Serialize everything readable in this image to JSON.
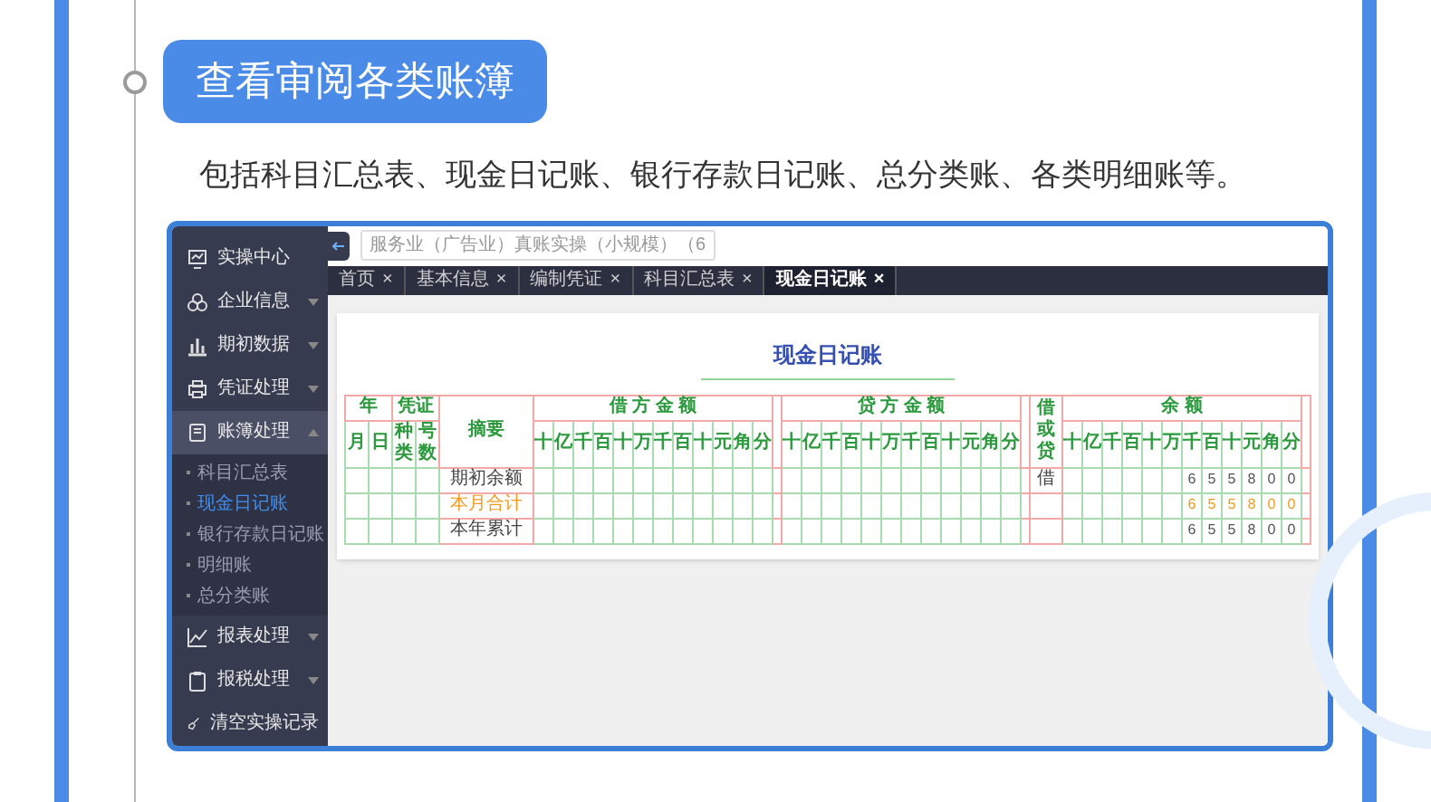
{
  "page": {
    "title": "查看审阅各类账簿",
    "description": "包括科目汇总表、现金日记账、银行存款日记账、总分类账、各类明细账等。"
  },
  "app": {
    "sidebar": {
      "items": [
        {
          "label": "实操中心",
          "kind": "link"
        },
        {
          "label": "企业信息",
          "kind": "group",
          "expanded": false
        },
        {
          "label": "期初数据",
          "kind": "group",
          "expanded": false
        },
        {
          "label": "凭证处理",
          "kind": "group",
          "expanded": false
        },
        {
          "label": "账簿处理",
          "kind": "group",
          "expanded": true,
          "children": [
            {
              "label": "科目汇总表",
              "selected": false
            },
            {
              "label": "现金日记账",
              "selected": true
            },
            {
              "label": "银行存款日记账",
              "selected": false
            },
            {
              "label": "明细账",
              "selected": false
            },
            {
              "label": "总分类账",
              "selected": false
            }
          ]
        },
        {
          "label": "报表处理",
          "kind": "group",
          "expanded": false
        },
        {
          "label": "报税处理",
          "kind": "group",
          "expanded": false
        },
        {
          "label": "清空实操记录",
          "kind": "link"
        }
      ]
    },
    "search": {
      "value": "服务业（广告业）真账实操（小规模）（6"
    },
    "tabs": [
      {
        "label": "首页",
        "close": "×",
        "selected": false
      },
      {
        "label": "基本信息",
        "close": "×",
        "selected": false
      },
      {
        "label": "编制凭证",
        "close": "×",
        "selected": false
      },
      {
        "label": "科目汇总表",
        "close": "×",
        "selected": false
      },
      {
        "label": "现金日记账",
        "close": "×",
        "selected": true
      }
    ],
    "ledger": {
      "title": "现金日记账",
      "headers": {
        "year": "年",
        "voucher": "凭证",
        "summary": "摘要",
        "debit": "借 方 金 额",
        "credit": "贷 方 金 额",
        "direction": "借或贷",
        "balance": "余 额",
        "month": "月",
        "day": "日",
        "voucher_type": "种类",
        "voucher_no": "号数"
      },
      "debit_units": [
        "十",
        "亿",
        "千",
        "百",
        "十",
        "万",
        "千",
        "百",
        "十",
        "元",
        "角",
        "分"
      ],
      "credit_units": [
        "十",
        "亿",
        "千",
        "百",
        "十",
        "万",
        "千",
        "百",
        "十",
        "元",
        "角",
        "分"
      ],
      "balance_units": [
        "十",
        "亿",
        "千",
        "百",
        "十",
        "万",
        "千",
        "百",
        "十",
        "元",
        "角",
        "分"
      ],
      "rows": [
        {
          "summary": "期初余额",
          "highlighted": false,
          "direction": "借",
          "balance_digits": [
            "6",
            "5",
            "5",
            "8",
            "0",
            "0"
          ]
        },
        {
          "summary": "本月合计",
          "highlighted": true,
          "balance_digits": [
            "6",
            "5",
            "5",
            "8",
            "0",
            "0"
          ]
        },
        {
          "summary": "本年累计",
          "highlighted": false,
          "balance_digits": [
            "6",
            "5",
            "5",
            "8",
            "0",
            "0"
          ]
        }
      ]
    }
  }
}
